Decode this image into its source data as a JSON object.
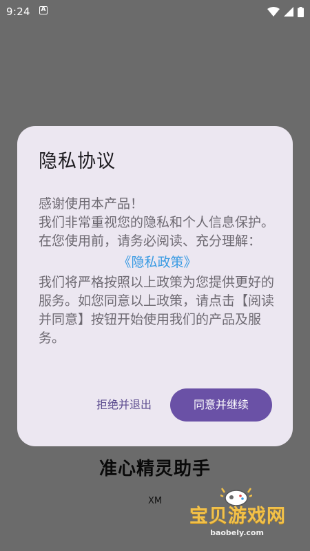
{
  "status_bar": {
    "time": "9:24",
    "badge": "A",
    "icons": [
      "wifi-icon",
      "signal-icon",
      "battery-icon"
    ]
  },
  "app": {
    "title": "准心精灵助手",
    "subtitle": "XM"
  },
  "dialog": {
    "title": "隐私协议",
    "intro_lines": [
      "感谢使用本产品！",
      "我们非常重视您的隐私和个人信息保护。在您使用前，请务必阅读、充分理解："
    ],
    "policy_link": "《隐私政策》",
    "outro": "我们将严格按照以上政策为您提供更好的服务。如您同意以上政策，请点击【阅读并同意】按钮开始使用我们的产品及服务。",
    "reject_label": "拒绝并退出",
    "accept_label": "同意并继续"
  },
  "watermark": {
    "text": "宝贝游戏网",
    "url": "baobely.com"
  },
  "colors": {
    "scrim": "#6b6b6b",
    "dialog_bg": "#ece7f1",
    "accent": "#6a51a6",
    "link": "#3a9be3",
    "body_text": "#6e6a72"
  }
}
